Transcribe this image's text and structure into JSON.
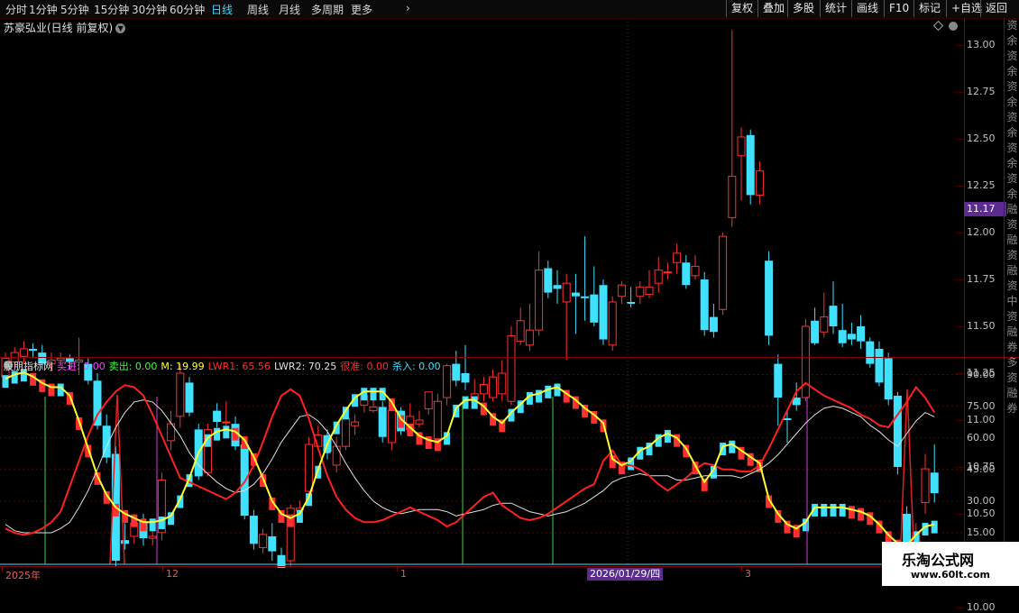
{
  "toolbar": {
    "periods": [
      "分时",
      "1分钟",
      "5分钟",
      "15分钟",
      "30分钟",
      "60分钟",
      "日线",
      "周线",
      "月线",
      "多周期",
      "更多"
    ],
    "active_period": "日线",
    "buttons": [
      "复权",
      "叠加",
      "多股",
      "统计",
      "画线",
      "F10",
      "标记",
      "+自选",
      "返回"
    ]
  },
  "stock": {
    "title": "苏豪弘业(日线 前复权)"
  },
  "price_axis": {
    "labels": [
      "13.00",
      "12.75",
      "12.50",
      "12.25",
      "12.00",
      "11.75",
      "11.50",
      "11.25",
      "11.00",
      "10.75",
      "10.50",
      "10.25",
      "10.00"
    ],
    "current_price": "11.17"
  },
  "indicator": {
    "name": "股朋指标网",
    "items": [
      {
        "label": "买进:",
        "value": "0.00",
        "color": "#ff40ff"
      },
      {
        "label": "卖出:",
        "value": "0.00",
        "color": "#40ff40"
      },
      {
        "label": "M:",
        "value": "19.99",
        "color": "#ffff40"
      },
      {
        "label": "LWR1:",
        "value": "65.56",
        "color": "#ff3030"
      },
      {
        "label": "LWR2:",
        "value": "70.25",
        "color": "#e0e0e0"
      },
      {
        "label": "很准:",
        "value": "0.00",
        "color": "#ff3030"
      },
      {
        "label": "杀入:",
        "value": "0.00",
        "color": "#40e0ff"
      }
    ],
    "axis_labels": [
      "90.00",
      "75.00",
      "60.00",
      "45.00",
      "30.00",
      "15.00"
    ]
  },
  "date_axis": {
    "labels": [
      "2025年",
      "12",
      "1",
      "3"
    ],
    "cursor_date": "2026/01/29/四"
  },
  "right_strip": [
    "资",
    "余",
    "资",
    "余",
    "资",
    "余",
    "资",
    "余",
    "资",
    "余",
    "资",
    "余",
    "融",
    "资",
    "融",
    "资",
    "融",
    "资",
    "中",
    "资",
    "融",
    "券",
    "多",
    "资",
    "融",
    "券"
  ],
  "watermark": {
    "title": "乐淘公式网",
    "url": "www.60lt.com"
  },
  "colors": {
    "up": "#ff3030",
    "down": "#40e0ff",
    "active_tab": "#3fd9ff",
    "purple_tag": "#5b2b8f"
  },
  "chart_data": {
    "type": "candlestick",
    "candles": [
      [
        11.23,
        11.33,
        11.36,
        11.2
      ],
      [
        11.31,
        11.36,
        11.39,
        11.28
      ],
      [
        11.34,
        11.38,
        11.42,
        11.3
      ],
      [
        11.38,
        11.37,
        11.41,
        11.33
      ],
      [
        11.36,
        11.3,
        11.4,
        11.28
      ],
      [
        11.3,
        11.32,
        11.36,
        11.26
      ],
      [
        11.32,
        11.33,
        11.36,
        11.29
      ],
      [
        11.33,
        11.31,
        11.35,
        11.27
      ],
      [
        11.31,
        11.32,
        11.44,
        11.24
      ],
      [
        11.3,
        11.21,
        11.33,
        11.19
      ],
      [
        11.21,
        10.97,
        11.25,
        10.95
      ],
      [
        10.97,
        10.8,
        11.03,
        10.77
      ],
      [
        10.82,
        10.25,
        10.86,
        10.22
      ],
      [
        10.36,
        10.34,
        10.45,
        10.31
      ],
      [
        10.38,
        10.45,
        10.49,
        10.34
      ],
      [
        10.46,
        10.37,
        10.5,
        10.33
      ],
      [
        10.37,
        10.38,
        10.44,
        10.33
      ],
      [
        10.4,
        10.68,
        10.72,
        10.36
      ],
      [
        10.89,
        10.98,
        11.05,
        10.84
      ],
      [
        11.02,
        11.25,
        11.3,
        10.96
      ],
      [
        11.2,
        11.04,
        11.23,
        11.02
      ],
      [
        10.95,
        10.7,
        10.98,
        10.68
      ],
      [
        10.72,
        10.95,
        10.98,
        10.7
      ],
      [
        11.05,
        10.99,
        11.09,
        10.96
      ],
      [
        10.99,
        10.99,
        11.1,
        10.97
      ],
      [
        10.98,
        10.86,
        11.02,
        10.84
      ],
      [
        10.87,
        10.49,
        10.9,
        10.47
      ],
      [
        10.49,
        10.34,
        10.52,
        10.31
      ],
      [
        10.32,
        10.39,
        10.42,
        10.29
      ],
      [
        10.38,
        10.3,
        10.45,
        10.25
      ],
      [
        10.28,
        10.16,
        10.32,
        10.1
      ],
      [
        10.25,
        10.53,
        10.55,
        10.22
      ],
      [
        10.52,
        10.53,
        10.57,
        10.48
      ],
      [
        10.62,
        10.87,
        10.91,
        10.56
      ],
      [
        10.86,
        10.92,
        10.97,
        10.84
      ],
      [
        10.92,
        10.83,
        10.95,
        10.79
      ],
      [
        10.76,
        10.86,
        10.91,
        10.72
      ],
      [
        10.86,
        11.01,
        11.04,
        10.84
      ],
      [
        10.97,
        10.99,
        11.03,
        10.92
      ],
      [
        11.08,
        11.13,
        11.16,
        11.04
      ],
      [
        11.05,
        11.07,
        11.12,
        11.04
      ],
      [
        11.07,
        10.91,
        11.1,
        10.88
      ],
      [
        10.88,
        11.05,
        11.08,
        10.84
      ],
      [
        11.05,
        10.94,
        11.07,
        10.92
      ],
      [
        10.95,
        11.02,
        11.09,
        10.92
      ],
      [
        10.98,
        11.0,
        11.05,
        10.96
      ],
      [
        11.06,
        11.15,
        11.12,
        11.03
      ],
      [
        10.9,
        11.1,
        11.14,
        10.88
      ],
      [
        11.12,
        11.29,
        11.3,
        11.08
      ],
      [
        11.3,
        11.21,
        11.37,
        11.18
      ],
      [
        11.25,
        11.2,
        11.4,
        11.16
      ],
      [
        11.11,
        11.14,
        11.22,
        11.1
      ],
      [
        11.14,
        11.19,
        11.23,
        11.1
      ],
      [
        11.12,
        11.23,
        11.27,
        11.1
      ],
      [
        11.14,
        11.25,
        11.32,
        11.1
      ],
      [
        11.1,
        11.45,
        11.5,
        11.08
      ],
      [
        11.42,
        11.53,
        11.6,
        11.4
      ],
      [
        11.4,
        11.48,
        11.62,
        11.37
      ],
      [
        11.48,
        11.8,
        11.9,
        11.45
      ],
      [
        11.81,
        11.68,
        11.85,
        11.65
      ],
      [
        11.72,
        11.7,
        11.8,
        11.62
      ],
      [
        11.63,
        11.73,
        11.78,
        11.32
      ],
      [
        11.68,
        11.66,
        11.78,
        11.46
      ],
      [
        11.66,
        11.65,
        11.98,
        11.53
      ],
      [
        11.67,
        11.52,
        11.82,
        11.5
      ],
      [
        11.72,
        11.43,
        11.75,
        11.4
      ],
      [
        11.4,
        11.63,
        11.66,
        11.37
      ],
      [
        11.66,
        11.72,
        11.74,
        11.62
      ],
      [
        11.63,
        11.62,
        11.71,
        11.6
      ],
      [
        11.66,
        11.71,
        11.74,
        11.62
      ],
      [
        11.67,
        11.71,
        11.8,
        11.65
      ],
      [
        11.73,
        11.8,
        11.87,
        11.68
      ],
      [
        11.79,
        11.79,
        11.84,
        11.75
      ],
      [
        11.84,
        11.89,
        11.94,
        11.78
      ],
      [
        11.84,
        11.72,
        11.88,
        11.7
      ],
      [
        11.77,
        11.82,
        11.88,
        11.75
      ],
      [
        11.75,
        11.48,
        11.79,
        11.45
      ],
      [
        11.55,
        11.47,
        11.62,
        11.44
      ],
      [
        11.59,
        11.98,
        12.0,
        11.56
      ],
      [
        12.08,
        12.3,
        13.08,
        12.03
      ],
      [
        12.41,
        12.51,
        12.56,
        12.17
      ],
      [
        12.52,
        12.2,
        12.55,
        12.15
      ],
      [
        12.2,
        12.33,
        12.38,
        12.15
      ],
      [
        11.85,
        11.45,
        11.9,
        11.4
      ],
      [
        11.3,
        11.12,
        11.35,
        10.97
      ],
      [
        11.01,
        11.0,
        11.06,
        10.88
      ],
      [
        11.12,
        11.08,
        11.2,
        11.05
      ],
      [
        11.12,
        11.5,
        11.54,
        11.1
      ],
      [
        11.53,
        11.41,
        11.6,
        11.4
      ],
      [
        11.47,
        11.55,
        11.68,
        11.44
      ],
      [
        11.61,
        11.5,
        11.74,
        11.46
      ],
      [
        11.48,
        11.41,
        11.62,
        11.39
      ],
      [
        11.46,
        11.43,
        11.52,
        11.4
      ],
      [
        11.5,
        11.42,
        11.56,
        11.38
      ],
      [
        11.42,
        11.3,
        11.44,
        11.28
      ],
      [
        11.38,
        11.2,
        11.42,
        11.18
      ],
      [
        11.33,
        11.11,
        11.36,
        11.08
      ],
      [
        11.13,
        10.75,
        11.15,
        10.71
      ],
      [
        10.5,
        9.87,
        10.54,
        9.83
      ],
      [
        9.96,
        10.4,
        10.45,
        9.96
      ],
      [
        10.56,
        10.74,
        10.82,
        10.5
      ],
      [
        10.72,
        10.61,
        10.87,
        10.56
      ]
    ],
    "indicator_series": {
      "M": [
        88,
        90,
        91,
        89,
        86,
        84,
        84,
        80,
        68,
        55,
        42,
        33,
        27,
        24,
        22,
        20,
        20,
        21,
        23,
        31,
        41,
        53,
        60,
        63,
        64,
        63,
        59,
        51,
        41,
        30,
        24,
        22,
        24,
        32,
        45,
        57,
        66,
        73,
        79,
        82,
        82,
        82,
        77,
        69,
        65,
        61,
        59,
        58,
        61,
        74,
        78,
        78,
        75,
        70,
        67,
        72,
        76,
        80,
        81,
        83,
        84,
        81,
        78,
        74,
        71,
        67,
        50,
        47,
        49,
        54,
        56,
        60,
        62,
        60,
        55,
        47,
        39,
        45,
        56,
        57,
        54,
        51,
        48,
        31,
        24,
        19,
        17,
        20,
        27,
        27,
        27,
        27,
        26,
        25,
        23,
        19,
        14,
        10,
        9,
        14,
        18,
        19
      ],
      "LWR1": [
        17,
        15,
        14,
        15,
        17,
        20,
        25,
        37,
        49,
        61,
        71,
        77,
        82,
        85,
        84,
        80,
        71,
        61,
        51,
        41,
        39,
        37,
        35,
        33,
        31,
        34,
        39,
        47,
        58,
        70,
        80,
        83,
        80,
        69,
        55,
        42,
        32,
        26,
        22,
        20,
        20,
        21,
        23,
        25,
        27,
        25,
        23,
        21,
        18,
        20,
        24,
        28,
        32,
        34,
        28,
        25,
        22,
        21,
        22,
        24,
        27,
        30,
        33,
        36,
        38,
        49,
        54,
        47,
        47,
        45,
        42,
        38,
        35,
        38,
        41,
        45,
        48,
        47,
        45,
        45,
        44,
        44,
        47,
        55,
        64,
        73,
        82,
        86,
        83,
        80,
        78,
        76,
        74,
        71,
        69,
        66,
        65,
        71,
        77,
        84,
        79,
        72
      ],
      "LWR2": [
        19,
        16,
        15,
        15,
        15,
        15,
        17,
        20,
        27,
        35,
        45,
        56,
        65,
        72,
        77,
        78,
        77,
        73,
        67,
        61,
        53,
        47,
        43,
        39,
        36,
        34,
        35,
        38,
        43,
        50,
        58,
        64,
        70,
        71,
        68,
        63,
        56,
        48,
        41,
        35,
        30,
        27,
        25,
        24,
        25,
        26,
        26,
        26,
        25,
        23,
        24,
        25,
        26,
        28,
        29,
        29,
        27,
        25,
        24,
        23,
        24,
        25,
        27,
        29,
        32,
        35,
        39,
        41,
        42,
        43,
        42,
        42,
        42,
        40,
        40,
        41,
        42,
        42,
        42,
        42,
        41,
        43,
        45,
        48,
        52,
        57,
        62,
        67,
        71,
        74,
        75,
        74,
        72,
        70,
        66,
        63,
        59,
        56,
        62,
        68,
        72,
        70
      ]
    }
  }
}
